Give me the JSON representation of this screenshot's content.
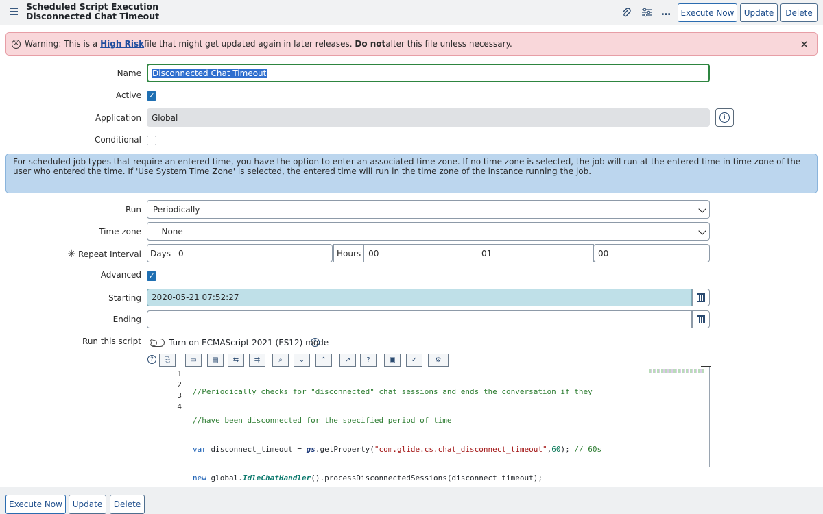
{
  "header": {
    "title_line1": "Scheduled Script Execution",
    "title_line2": "Disconnected Chat Timeout",
    "execute_now": "Execute Now",
    "update": "Update",
    "delete": "Delete",
    "more_icon": "…"
  },
  "warning": {
    "prefix": "Warning: This is a ",
    "link": "High Risk",
    "middle": " file that might get updated again in later releases. ",
    "bold": "Do not",
    "suffix": " alter this file unless necessary."
  },
  "form": {
    "name_label": "Name",
    "name_value": "Disconnected Chat Timeout",
    "active_label": "Active",
    "active_checked": true,
    "application_label": "Application",
    "application_value": "Global",
    "conditional_label": "Conditional",
    "conditional_checked": false,
    "info_text": "For scheduled job types that require an entered time, you have the option to enter an associated time zone. If no time zone is selected, the job will run at the entered time in time zone of the user who entered the time. If 'Use System Time Zone' is selected, the entered time will run in the time zone of the instance running the job.",
    "run_label": "Run",
    "run_value": "Periodically",
    "timezone_label": "Time zone",
    "timezone_value": "-- None --",
    "repeat_label": "Repeat Interval",
    "days_label": "Days",
    "days_value": "0",
    "hours_label": "Hours",
    "hours_value": "00",
    "minutes_value": "01",
    "seconds_value": "00",
    "advanced_label": "Advanced",
    "advanced_checked": true,
    "starting_label": "Starting",
    "starting_value": "2020-05-21 07:52:27",
    "ending_label": "Ending",
    "ending_value": "",
    "run_script_label": "Run this script",
    "es12_label": "Turn on ECMAScript 2021 (ES12) mode"
  },
  "script": {
    "line_numbers": [
      "1",
      "2",
      "3",
      "4"
    ],
    "line1": "//Periodically checks for \"disconnected\" chat sessions and ends the conversation if they",
    "line2": "//have been disconnected for the specified period of time",
    "line3_kw": "var",
    "line3_a": " disconnect_timeout = ",
    "line3_gs": "gs",
    "line3_b": ".getProperty(",
    "line3_str": "\"com.glide.cs.chat_disconnect_timeout\"",
    "line3_c": ",",
    "line3_num": "60",
    "line3_d": "); ",
    "line3_comment": "// 60s",
    "line4_kw": "new",
    "line4_a": " global.",
    "line4_cls": "IdleChatHandler",
    "line4_b": "().processDisconnectedSessions(disconnect_timeout);"
  },
  "footer": {
    "execute_now": "Execute Now",
    "update": "Update",
    "delete": "Delete"
  }
}
